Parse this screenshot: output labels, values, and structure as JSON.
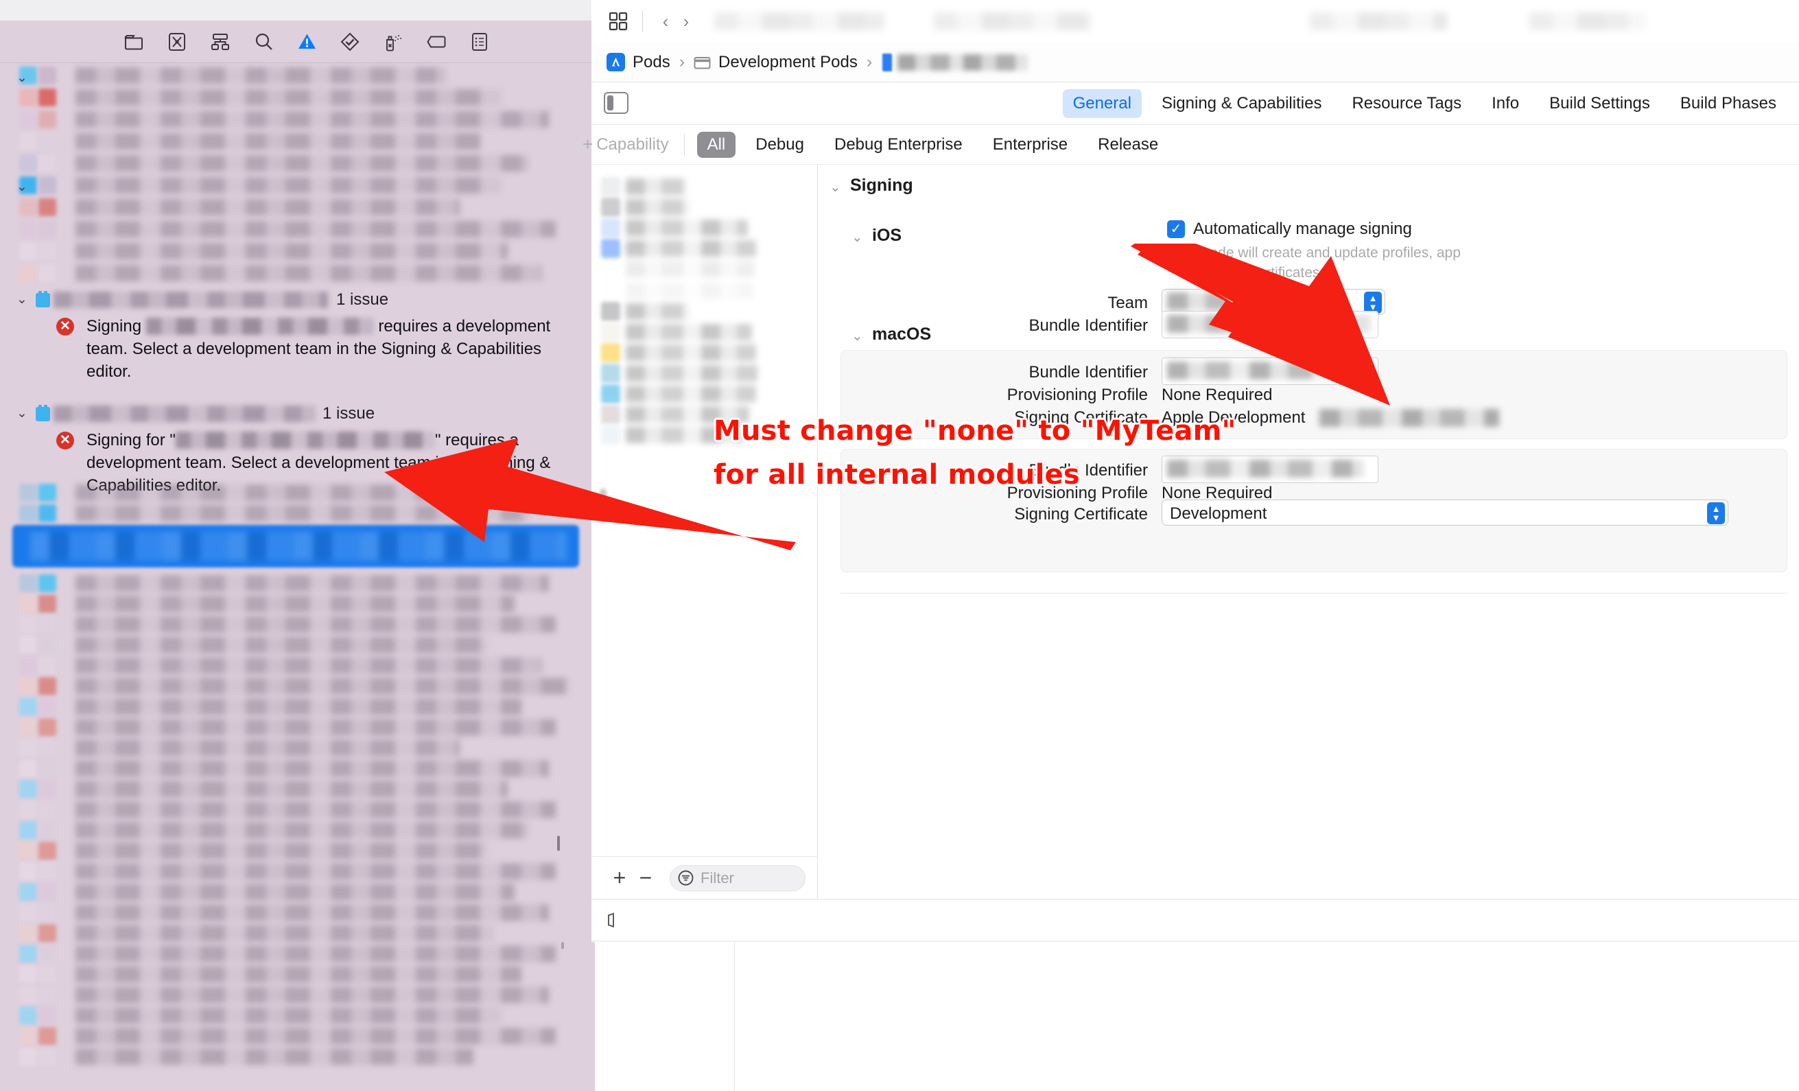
{
  "window": {
    "title": ""
  },
  "navigator": {
    "toolbar_icons": [
      {
        "name": "folder-icon",
        "label": "Project navigator"
      },
      {
        "name": "source-control-icon",
        "label": "Source control navigator"
      },
      {
        "name": "hierarchy-icon",
        "label": "Symbol navigator"
      },
      {
        "name": "search-icon",
        "label": "Find navigator"
      },
      {
        "name": "warning-triangle-icon",
        "label": "Issue navigator"
      },
      {
        "name": "test-diamond-icon",
        "label": "Test navigator"
      },
      {
        "name": "debug-spray-icon",
        "label": "Debug navigator"
      },
      {
        "name": "breakpoint-tag-icon",
        "label": "Breakpoint navigator"
      },
      {
        "name": "report-list-icon",
        "label": "Report navigator"
      }
    ],
    "issue_groups": [
      {
        "count_label": "1 issue",
        "error": {
          "prefix": "Signing ",
          "redacted_mid": true,
          "suffix": " requires a development team. Select a development team in the Signing & Capabilities editor."
        }
      },
      {
        "count_label": "1 issue",
        "error": {
          "prefix": "Signing for \"",
          "redacted_mid": true,
          "suffix": "\" requires a development team. Select a development team in the Signing & Capabilities editor."
        }
      }
    ]
  },
  "editor": {
    "toolbar": {
      "grid_icon": "grid-icon",
      "back_icon": "chevron-left-icon",
      "forward_icon": "chevron-right-icon"
    },
    "breadcrumb": {
      "app_icon": "xcode-app-icon",
      "items": [
        {
          "label": "Pods",
          "icon": "xcode-app-icon"
        },
        {
          "label": "Development Pods",
          "icon": "folder-icon"
        },
        {
          "label": "",
          "icon": "file-icon",
          "redacted": true
        }
      ],
      "separator": "›"
    },
    "sidebar_toggle": "sidebar-toggle-icon",
    "tabs": [
      {
        "label": "General",
        "selected": true
      },
      {
        "label": "Signing & Capabilities",
        "selected": false
      },
      {
        "label": "Resource Tags",
        "selected": false
      },
      {
        "label": "Info",
        "selected": false
      },
      {
        "label": "Build Settings",
        "selected": false
      },
      {
        "label": "Build Phases",
        "selected": false
      }
    ],
    "capability_button": {
      "plus": "+",
      "label": "Capability"
    },
    "configurations": [
      {
        "label": "All",
        "selected": true
      },
      {
        "label": "Debug",
        "selected": false
      },
      {
        "label": "Debug Enterprise",
        "selected": false
      },
      {
        "label": "Enterprise",
        "selected": false
      },
      {
        "label": "Release",
        "selected": false
      }
    ],
    "target_list": {
      "add_label": "+",
      "remove_label": "−",
      "filter_placeholder": "Filter",
      "filter_icon": "filter-icon"
    },
    "signing": {
      "section_title": "Signing",
      "auto_manage": {
        "checked": true,
        "label": "Automatically manage signing",
        "description": "Xcode will create and update profiles, app IDs, and certificates."
      },
      "team": {
        "label": "Team",
        "value": "",
        "redacted": true,
        "control": "popup-button"
      },
      "bundle_identifier": {
        "label": "Bundle Identifier",
        "value": "",
        "redacted": true,
        "control": "text-field"
      }
    },
    "ios_section": {
      "title": "iOS",
      "rows": [
        {
          "label": "Bundle Identifier",
          "value": "",
          "redacted": true,
          "control": "text-field"
        },
        {
          "label": "Provisioning Profile",
          "value": "None Required",
          "redacted": false,
          "control": "static-text"
        },
        {
          "label": "Signing Certificate",
          "value": "Apple Development",
          "redacted_suffix": true,
          "control": "static-text"
        }
      ]
    },
    "macos_section": {
      "title": "macOS",
      "rows": [
        {
          "label": "Bundle Identifier",
          "value": "",
          "redacted": true,
          "control": "text-field"
        },
        {
          "label": "Provisioning Profile",
          "value": "None Required",
          "redacted": false,
          "control": "static-text"
        },
        {
          "label": "Signing Certificate",
          "value": "Development",
          "redacted": false,
          "control": "popup-button"
        }
      ]
    },
    "debug_bar": {
      "icon": "console-toggle-icon"
    }
  },
  "annotation": {
    "line1": "Must change \"none\" to \"MyTeam\"",
    "line2": "for all internal modules",
    "color": "#ff1100",
    "arrows": [
      {
        "name": "arrow-to-team-field",
        "points_to": "Team popup button"
      },
      {
        "name": "arrow-to-navigator-selection",
        "points_to": "selected navigator row"
      }
    ]
  },
  "colors": {
    "navigator_bg": "#dfd0dd",
    "accent_blue": "#1a7aec",
    "selected_tab_bg": "#d3e4fd",
    "selected_tab_text": "#0a6cf1",
    "config_selected_bg": "#8e8e93",
    "error_red": "#d7332c",
    "annotation_red": "#ff1100",
    "card_bg": "#f7f7f8"
  }
}
